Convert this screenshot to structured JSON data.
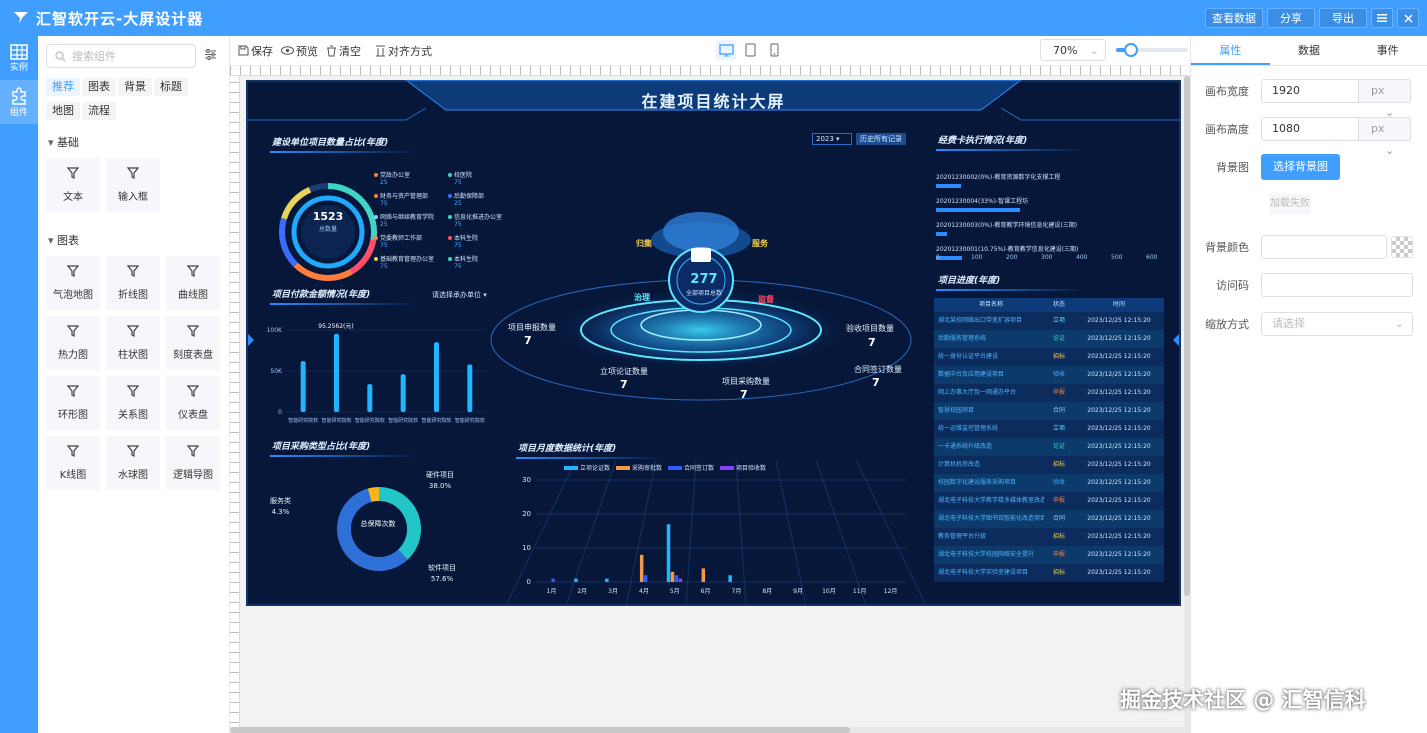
{
  "app": {
    "title": "汇智软开云-大屏设计器",
    "top_buttons": [
      "查看数据",
      "分享",
      "导出"
    ]
  },
  "rail": {
    "items": [
      {
        "label": "实例",
        "icon": "grid-icon"
      },
      {
        "label": "组件",
        "icon": "puzzle-icon"
      }
    ]
  },
  "components": {
    "search_placeholder": "搜索组件",
    "categories": [
      "推荐",
      "图表",
      "背景",
      "标题",
      "地图",
      "流程"
    ],
    "groups": [
      {
        "title": "基础",
        "items": [
          "文本",
          "输入框"
        ]
      },
      {
        "title": "图表",
        "items": [
          "气泡地图",
          "折线图",
          "曲线图",
          "热力图",
          "柱状图",
          "刻度表盘",
          "环形图",
          "关系图",
          "仪表盘",
          "K线图",
          "水球图",
          "逻辑导图"
        ]
      }
    ]
  },
  "toolbar": {
    "save": "保存",
    "preview": "预览",
    "clear": "清空",
    "align": "对齐方式",
    "zoom": "70%"
  },
  "props": {
    "tabs": [
      "属性",
      "数据",
      "事件"
    ],
    "canvas_width_label": "画布宽度",
    "canvas_width": "1920",
    "canvas_height_label": "画布高度",
    "canvas_height": "1080",
    "unit": "px",
    "bg_image_label": "背景图",
    "bg_image_button": "选择背景图",
    "load_failed": "加载失败",
    "bg_color_label": "背景颜色",
    "access_code_label": "访问码",
    "scale_label": "缩放方式",
    "scale_placeholder": "请选择"
  },
  "screen": {
    "title": "在建项目统计大屏",
    "panel_unit": "建设单位项目数量占比(年度)",
    "panel_pay": "项目付款金额情况(年度)",
    "panel_purchase": "项目采购类型占比(年度)",
    "panel_monthly": "项目月度数据统计(年度)",
    "panel_funds": "经费卡执行情况(年度)",
    "panel_progress": "项目进度(年度)",
    "year": "2023",
    "history_btn": "历史所有记录",
    "dept_select": "请选择承办单位",
    "ring_total": "1523",
    "ring_label": "总数量",
    "unit_legend": [
      {
        "name": "党政办公室",
        "value": "25",
        "color": "#ff7d3b"
      },
      {
        "name": "校医院",
        "value": "75",
        "color": "#3fd4c4"
      },
      {
        "name": "财务与资产管理部",
        "value": "75",
        "color": "#ff7d3b"
      },
      {
        "name": "后勤保障部",
        "value": "25",
        "color": "#3b6bff"
      },
      {
        "name": "网络与继续教育学院",
        "value": "25",
        "color": "#7dd3ff"
      },
      {
        "name": "信息化推进办公室",
        "value": "75",
        "color": "#3fd4c4"
      },
      {
        "name": "党委教师工作部",
        "value": "75",
        "color": "#ff7d3b"
      },
      {
        "name": "本科生院",
        "value": "75",
        "color": "#ff4d6a"
      },
      {
        "name": "基础教育管理办公室",
        "value": "75",
        "color": "#e6d35a"
      },
      {
        "name": "本科生院",
        "value": "75",
        "color": "#3fd4c4"
      }
    ],
    "center_total": "277",
    "center_label": "全部项目总数",
    "captions": [
      "归集",
      "服务",
      "治理",
      "监督"
    ],
    "stats": [
      {
        "label": "项目申报数量",
        "value": "7"
      },
      {
        "label": "验收项目数量",
        "value": "7"
      },
      {
        "label": "立项论证数量",
        "value": "7"
      },
      {
        "label": "项目采购数量",
        "value": "7"
      },
      {
        "label": "合同签订数量",
        "value": "7"
      }
    ],
    "funds": [
      {
        "label": "20201230002(0%)-教育资源数字化支撑工程",
        "value": 0
      },
      {
        "label": "20201230004(33%)-智课工程坊",
        "value": 33
      },
      {
        "label": "20201230003(0%)-教育教学环境信息化建设(三期)",
        "value": 0
      },
      {
        "label": "20201230001(10.75%)-教育教学信息化建设(三期)",
        "value": 10.75
      }
    ],
    "funds_ticks": [
      "0",
      "100",
      "200",
      "300",
      "400",
      "500",
      "600"
    ],
    "progress_headers": [
      "项目名称",
      "状态",
      "时间"
    ],
    "progress_rows": [
      {
        "name": "湖北某校网络出口带宽扩容项目",
        "status": "立项",
        "time": "2023/12/25 12:15:20"
      },
      {
        "name": "后勤服务管理系统",
        "status": "论证",
        "time": "2023/12/25 12:15:20"
      },
      {
        "name": "统一身份认证平台建设",
        "status": "招标",
        "time": "2023/12/25 12:15:20"
      },
      {
        "name": "数据中台及应用建设项目",
        "status": "验收",
        "time": "2023/12/25 12:15:20"
      },
      {
        "name": "网上办事大厅及一网通办平台",
        "status": "申报",
        "time": "2023/12/25 12:15:20"
      },
      {
        "name": "智慧校园项目",
        "status": "合同",
        "time": "2023/12/25 12:15:20"
      },
      {
        "name": "统一运维监控管理系统",
        "status": "立项",
        "time": "2023/12/25 12:15:20"
      },
      {
        "name": "一卡通系统升级改造",
        "status": "论证",
        "time": "2023/12/25 12:15:20"
      },
      {
        "name": "计算机机房改造",
        "status": "招标",
        "time": "2023/12/25 12:15:20"
      },
      {
        "name": "校园数字化建设服务采购项目",
        "status": "验收",
        "time": "2023/12/25 12:15:20"
      },
      {
        "name": "湖北电子科技大学教学楼多媒体教室改造",
        "status": "申报",
        "time": "2023/12/25 12:15:20"
      },
      {
        "name": "湖北电子科技大学图书馆智能化改造项目",
        "status": "合同",
        "time": "2023/12/25 12:15:20"
      },
      {
        "name": "教务管理平台升级",
        "status": "招标",
        "time": "2023/12/25 12:15:20"
      },
      {
        "name": "湖北电子科技大学校园网络安全提升",
        "status": "申报",
        "time": "2023/12/25 12:15:20"
      },
      {
        "name": "湖北电子科技大学实验室建设项目",
        "status": "招标",
        "time": "2023/12/25 12:15:20"
      }
    ],
    "purchase_center": "总保障次数",
    "purchase": [
      {
        "name": "硬件项目",
        "value": 38.0,
        "label": "38.0%",
        "color": "#23c6c8"
      },
      {
        "name": "软件项目",
        "value": 57.6,
        "label": "57.6%",
        "color": "#2f6fd8"
      },
      {
        "name": "服务类",
        "value": 4.3,
        "label": "4.3%",
        "color": "#f6b61c"
      }
    ],
    "monthly_legend": [
      {
        "name": "立项论证数",
        "color": "#1fb6ff"
      },
      {
        "name": "采购审批数",
        "color": "#f39a4a"
      },
      {
        "name": "合同签订数",
        "color": "#2f5bff"
      },
      {
        "name": "项目验收数",
        "color": "#8c3fff"
      }
    ]
  },
  "chart_data": [
    {
      "type": "bar",
      "title": "项目付款金额情况(年度)",
      "categories": [
        "智能研究院软件开发与研究平台",
        "智能研究院软件开发与研究平台",
        "智能研究院软件开发与研究平台",
        "智能研究院软件开发与研究平台",
        "智能研究院软件开发与研究平台",
        "智能研究院软件开发与研究平台"
      ],
      "values": [
        62000,
        95256,
        34000,
        46000,
        85000,
        58000
      ],
      "ylim": [
        0,
        100000
      ],
      "yticks": [
        "0",
        "50K",
        "100K"
      ],
      "annotation": "95.2562(元)"
    },
    {
      "type": "bar",
      "title": "项目月度数据统计(年度)",
      "categories": [
        "1月",
        "2月",
        "3月",
        "4月",
        "5月",
        "6月",
        "7月",
        "8月",
        "9月",
        "10月",
        "11月",
        "12月"
      ],
      "series": [
        {
          "name": "立项论证数",
          "values": [
            0,
            1,
            1,
            0,
            17,
            0,
            2,
            0,
            0,
            0,
            0,
            0
          ]
        },
        {
          "name": "采购审批数",
          "values": [
            0,
            0,
            0,
            8,
            3,
            4,
            0,
            0,
            0,
            0,
            0,
            0
          ]
        },
        {
          "name": "合同签订数",
          "values": [
            1,
            0,
            0,
            2,
            2,
            0,
            0,
            0,
            0,
            0,
            0,
            0
          ]
        },
        {
          "name": "项目验收数",
          "values": [
            0,
            0,
            0,
            0,
            1,
            0,
            0,
            0,
            0,
            0,
            0,
            0
          ]
        }
      ],
      "ylim": [
        0,
        30
      ],
      "yticks": [
        "0",
        "10",
        "20",
        "30"
      ]
    },
    {
      "type": "pie",
      "title": "项目采购类型占比(年度)",
      "categories": [
        "硬件项目",
        "软件项目",
        "服务类"
      ],
      "values": [
        38.0,
        57.6,
        4.3
      ]
    },
    {
      "type": "bar",
      "title": "经费卡执行情况(年度)",
      "categories": [
        "20201230002",
        "20201230004",
        "20201230003",
        "20201230001"
      ],
      "values": [
        70,
        240,
        30,
        75
      ],
      "xlim": [
        0,
        600
      ]
    }
  ]
}
